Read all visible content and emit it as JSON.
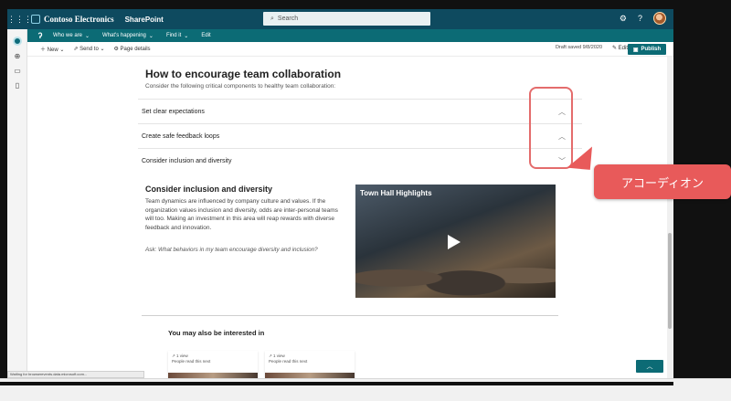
{
  "suite": {
    "brand": "Contoso Electronics",
    "app": "SharePoint",
    "search_placeholder": "Search",
    "settings_icon": "gear-icon",
    "help_icon": "?"
  },
  "sitenav": {
    "items": [
      {
        "label": "Who we are"
      },
      {
        "label": "What's happening"
      },
      {
        "label": "Find it"
      },
      {
        "label": "Edit"
      }
    ]
  },
  "cmdbar": {
    "new_label": "New",
    "send_label": "Send to",
    "details_label": "Page details",
    "draft_status": "Draft saved 9/8/2020",
    "edit_label": "Edit",
    "publish_label": "Publish"
  },
  "page": {
    "title": "How to encourage team collaboration",
    "subtitle": "Consider the following critical components to healthy team collaboration:",
    "accordion": [
      {
        "label": "Set clear expectations",
        "chevron": "^"
      },
      {
        "label": "Create safe feedback loops",
        "chevron": "^"
      },
      {
        "label": "Consider inclusion and diversity",
        "chevron": "v"
      }
    ],
    "section": {
      "title": "Consider inclusion and diversity",
      "body": "Team dynamics are influenced by company culture and values. If the organization values inclusion and diversity, odds are inter-personal teams will too. Making an investment in this area will reap rewards with diverse feedback and innovation.",
      "ask": "Ask: What behaviors in my team encourage diversity and inclusion?"
    },
    "video": {
      "title": "Town Hall Highlights"
    },
    "related_title": "You may also be interested in",
    "cards": [
      {
        "views": "1 view",
        "note": "People read this next"
      },
      {
        "views": "1 view",
        "note": "People read this next"
      }
    ]
  },
  "annotation": {
    "label": "アコーディオン",
    "color": "#e85a5a"
  },
  "status_text": "Waiting for browserevents.data.microsoft.com..."
}
